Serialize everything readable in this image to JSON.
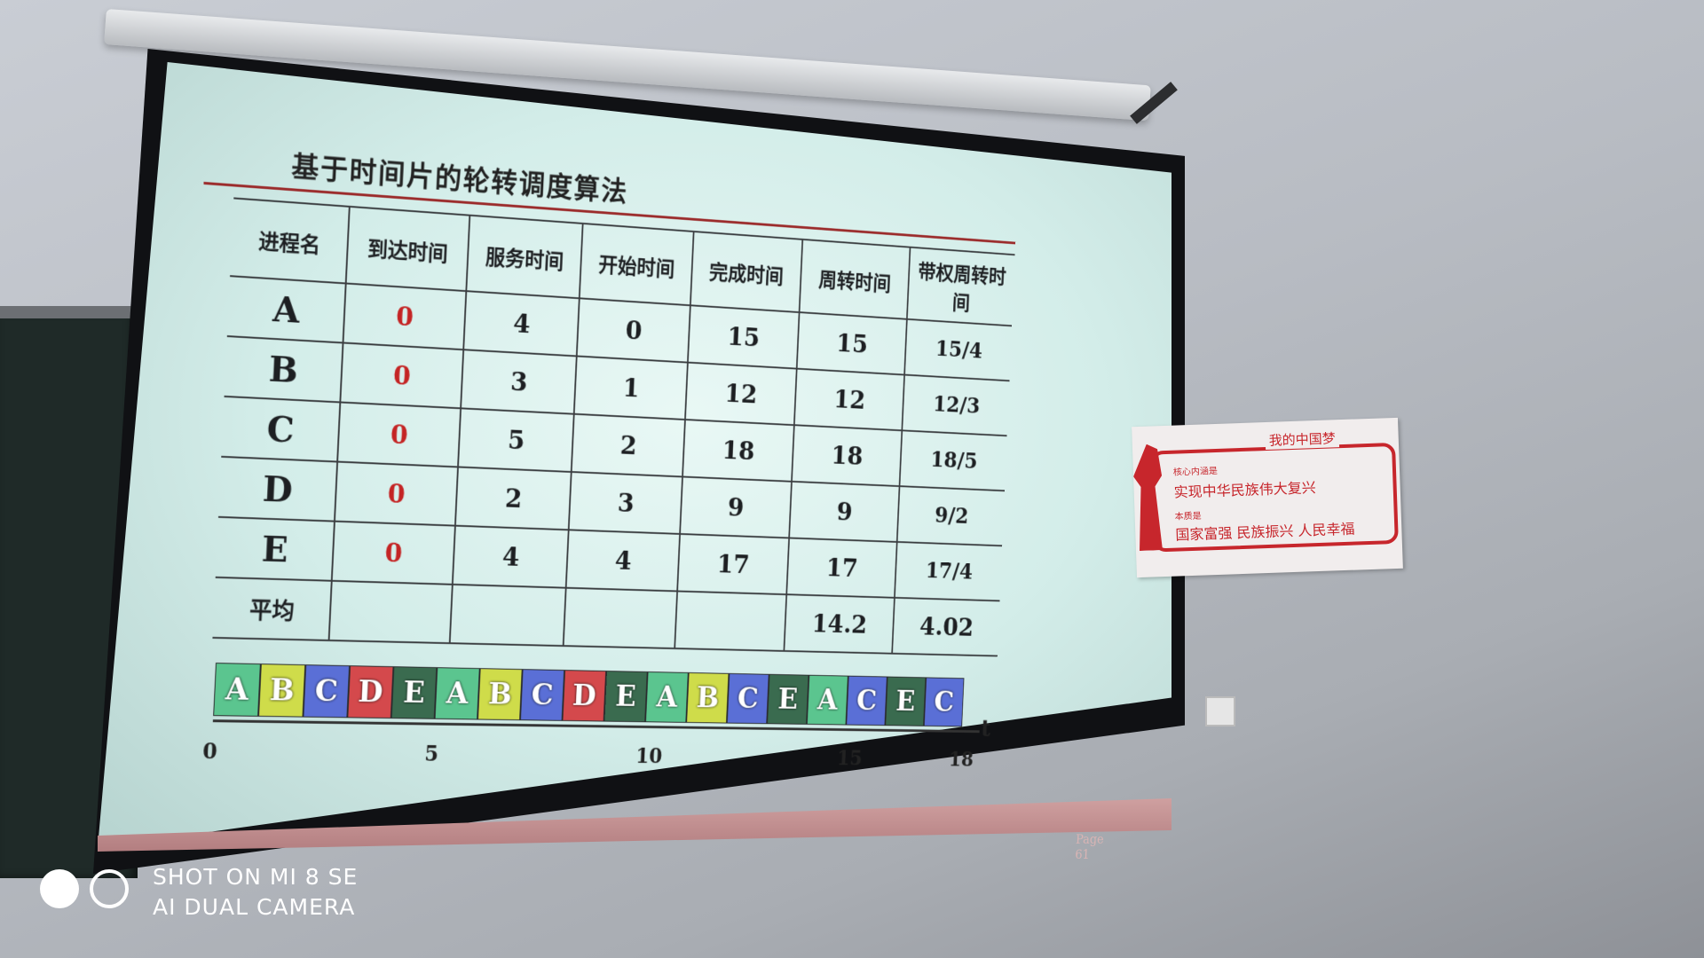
{
  "slide": {
    "title": "基于时间片的轮转调度算法",
    "headers": [
      "进程名",
      "到达时间",
      "服务时间",
      "开始时间",
      "完成时间",
      "周转时间",
      "带权周转时间"
    ],
    "rows": [
      [
        "A",
        "0",
        "4",
        "0",
        "15",
        "15",
        "15/4"
      ],
      [
        "B",
        "0",
        "3",
        "1",
        "12",
        "12",
        "12/3"
      ],
      [
        "C",
        "0",
        "5",
        "2",
        "18",
        "18",
        "18/5"
      ],
      [
        "D",
        "0",
        "2",
        "3",
        "9",
        "9",
        "9/2"
      ],
      [
        "E",
        "0",
        "4",
        "4",
        "17",
        "17",
        "17/4"
      ]
    ],
    "average": {
      "label": "平均",
      "turnaround": "14.2",
      "weighted": "4.02"
    },
    "gantt": {
      "sequence": [
        "A",
        "B",
        "C",
        "D",
        "E",
        "A",
        "B",
        "C",
        "D",
        "E",
        "A",
        "B",
        "C",
        "E",
        "A",
        "C",
        "E",
        "C"
      ],
      "axis_label": "t",
      "ticks": [
        "0",
        "5",
        "10",
        "15",
        "18"
      ],
      "colors": {
        "A": "#5bc58f",
        "B": "#cfdc4a",
        "C": "#5a6fd6",
        "D": "#d4494c",
        "E": "#3a6b4f"
      }
    },
    "page": "Page 61"
  },
  "poster": {
    "heading": "我的中国梦",
    "line1": "核心内涵是",
    "line2": "实现中华民族伟大复兴",
    "line3": "本质是",
    "line4": "国家富强 民族振兴 人民幸福"
  },
  "watermark": {
    "line1": "SHOT ON MI 8 SE",
    "line2": "AI DUAL CAMERA"
  }
}
